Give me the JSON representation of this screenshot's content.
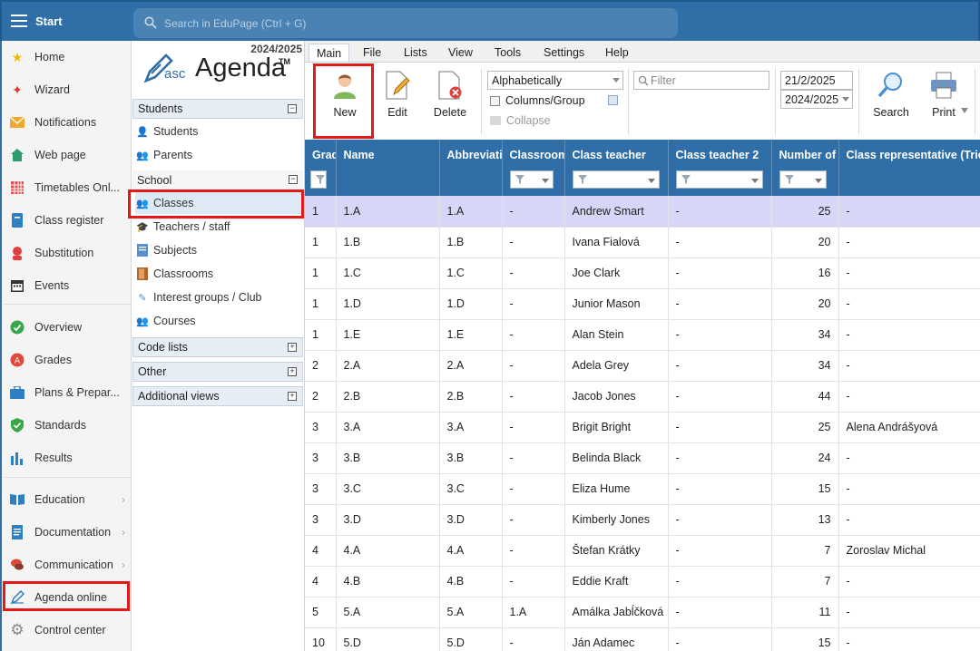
{
  "topbar": {
    "start_label": "Start",
    "search_placeholder": "Search in EduPage (Ctrl + G)"
  },
  "leftnav": {
    "items": [
      {
        "label": "Home",
        "icon": "star-icon"
      },
      {
        "label": "Wizard",
        "icon": "wand-icon"
      },
      {
        "label": "Notifications",
        "icon": "envelope-icon"
      },
      {
        "label": "Web page",
        "icon": "house-icon"
      },
      {
        "label": "Timetables Onl...",
        "icon": "timetable-icon"
      },
      {
        "label": "Class register",
        "icon": "register-icon"
      },
      {
        "label": "Substitution",
        "icon": "substitution-icon"
      },
      {
        "label": "Events",
        "icon": "calendar-icon"
      },
      {
        "label": "Overview",
        "icon": "check-circle-icon"
      },
      {
        "label": "Grades",
        "icon": "grades-icon"
      },
      {
        "label": "Plans & Prepar...",
        "icon": "briefcase-icon"
      },
      {
        "label": "Standards",
        "icon": "shield-check-icon"
      },
      {
        "label": "Results",
        "icon": "bar-chart-icon"
      },
      {
        "label": "Education",
        "icon": "book-icon"
      },
      {
        "label": "Documentation",
        "icon": "document-icon"
      },
      {
        "label": "Communication",
        "icon": "chat-icon"
      },
      {
        "label": "Agenda online",
        "icon": "pen-icon"
      },
      {
        "label": "Control center",
        "icon": "gear-icon"
      }
    ]
  },
  "logo": {
    "year": "2024/2025",
    "asc": "asc",
    "agenda": "Agenda",
    "tm": "TM"
  },
  "tree": {
    "students_header": "Students",
    "students_items": [
      "Students",
      "Parents"
    ],
    "school_header": "School",
    "school_items": [
      "Classes",
      "Teachers / staff",
      "Subjects",
      "Classrooms",
      "Interest groups / Club",
      "Courses"
    ],
    "code_lists": "Code lists",
    "other": "Other",
    "additional_views": "Additional views",
    "expand_glyph": "+",
    "collapse_glyph": "−"
  },
  "menu": {
    "tabs": [
      "Main",
      "File",
      "Lists",
      "View",
      "Tools",
      "Settings",
      "Help"
    ]
  },
  "toolbar": {
    "new_label": "New",
    "edit_label": "Edit",
    "delete_label": "Delete",
    "sort_value": "Alphabetically",
    "columns_group": "Columns/Group",
    "collapse": "Collapse",
    "filter_placeholder": "Filter",
    "date_value": "21/2/2025",
    "year_value": "2024/2025",
    "search_label": "Search",
    "print_label": "Print"
  },
  "grid": {
    "columns": [
      "Grade",
      "Name",
      "Abbreviation",
      "Classroom",
      "Class teacher",
      "Class teacher 2",
      "Number of students",
      "Class representative (Triedny dôverník)"
    ],
    "rows": [
      [
        "1",
        "1.A",
        "1.A",
        "-",
        "Andrew Smart",
        "-",
        "25",
        "-"
      ],
      [
        "1",
        "1.B",
        "1.B",
        "-",
        "Ivana Fialová",
        "-",
        "20",
        "-"
      ],
      [
        "1",
        "1.C",
        "1.C",
        "-",
        "Joe Clark",
        "-",
        "16",
        "-"
      ],
      [
        "1",
        "1.D",
        "1.D",
        "-",
        "Junior Mason",
        "-",
        "20",
        "-"
      ],
      [
        "1",
        "1.E",
        "1.E",
        "-",
        "Alan Stein",
        "-",
        "34",
        "-"
      ],
      [
        "2",
        "2.A",
        "2.A",
        "-",
        "Adela Grey",
        "-",
        "34",
        "-"
      ],
      [
        "2",
        "2.B",
        "2.B",
        "-",
        "Jacob Jones",
        "-",
        "44",
        "-"
      ],
      [
        "3",
        "3.A",
        "3.A",
        "-",
        "Brigit Bright",
        "-",
        "25",
        "Alena Andrášyová"
      ],
      [
        "3",
        "3.B",
        "3.B",
        "-",
        "Belinda Black",
        "-",
        "24",
        "-"
      ],
      [
        "3",
        "3.C",
        "3.C",
        "-",
        "Eliza Hume",
        "-",
        "15",
        "-"
      ],
      [
        "3",
        "3.D",
        "3.D",
        "-",
        "Kimberly Jones",
        "-",
        "13",
        "-"
      ],
      [
        "4",
        "4.A",
        "4.A",
        "-",
        "Štefan Krátky",
        "-",
        "7",
        "Zoroslav Michal"
      ],
      [
        "4",
        "4.B",
        "4.B",
        "-",
        "Eddie Kraft",
        "-",
        "7",
        "-"
      ],
      [
        "5",
        "5.A",
        "5.A",
        "1.A",
        "Amálka Jabĺčková",
        "-",
        "11",
        "-"
      ],
      [
        "10",
        "5.D",
        "5.D",
        "-",
        "Ján Adamec",
        "-",
        "15",
        "-"
      ]
    ]
  },
  "colors": {
    "header_blue": "#2f6ea6",
    "highlight_red": "#e21a1a",
    "selected_row": "#d6d6f6"
  }
}
